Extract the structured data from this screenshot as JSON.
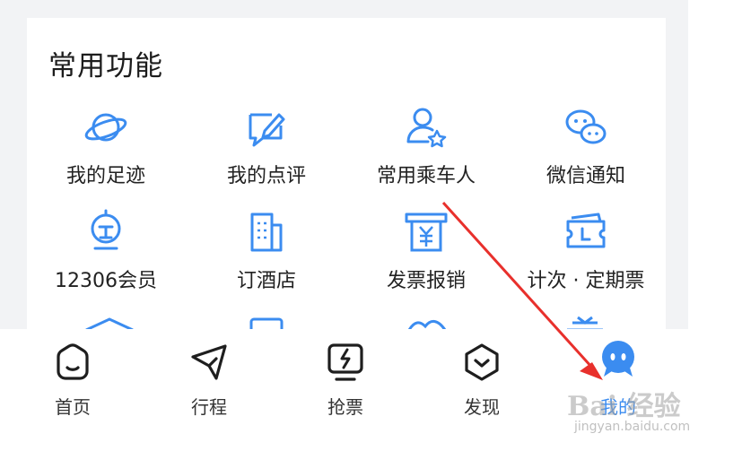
{
  "section": {
    "title": "常用功能"
  },
  "grid": [
    {
      "label": "我的足迹",
      "icon": "planet-icon"
    },
    {
      "label": "我的点评",
      "icon": "comment-edit-icon"
    },
    {
      "label": "常用乘车人",
      "icon": "passenger-star-icon"
    },
    {
      "label": "微信通知",
      "icon": "wechat-icon"
    },
    {
      "label": "12306会员",
      "icon": "member-icon"
    },
    {
      "label": "订酒店",
      "icon": "hotel-icon"
    },
    {
      "label": "发票报销",
      "icon": "invoice-icon"
    },
    {
      "label": "计次 · 定期票",
      "icon": "ticket-icon"
    }
  ],
  "tabbar": [
    {
      "label": "首页",
      "icon": "home-icon"
    },
    {
      "label": "行程",
      "icon": "paper-plane-icon"
    },
    {
      "label": "抢票",
      "icon": "lightning-screen-icon"
    },
    {
      "label": "发现",
      "icon": "discover-icon"
    },
    {
      "label": "我的",
      "icon": "profile-mascot-icon"
    }
  ],
  "watermark": {
    "brand": "Bai 经验",
    "url": "jingyan.baidu.com"
  },
  "colors": {
    "accent": "#3b8cf0",
    "arrow": "#e8302c",
    "text": "#222222"
  }
}
